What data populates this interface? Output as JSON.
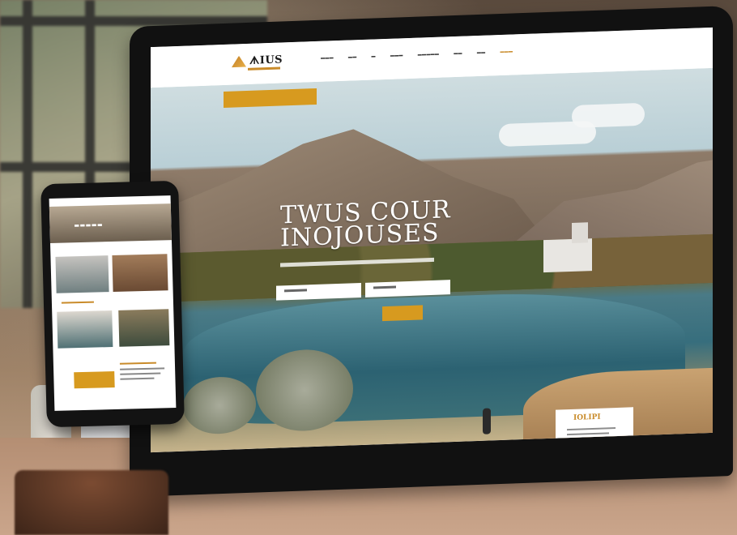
{
  "scene": {
    "description_colors": {
      "accent": "#d79a1f",
      "screen_bg": "#ffffff",
      "device": "#111111"
    }
  },
  "website": {
    "logo_text": "ᗑIUS",
    "nav": [
      "",
      "",
      "",
      "",
      "",
      "",
      "",
      ""
    ],
    "hero_title_line1": "TWUS COUR",
    "hero_title_line2": "INOJOUSES",
    "search_field_1": "",
    "search_field_2": "",
    "card_title": "IOLIPI"
  },
  "phone_site": {
    "hero_text": "",
    "section_title": ""
  }
}
